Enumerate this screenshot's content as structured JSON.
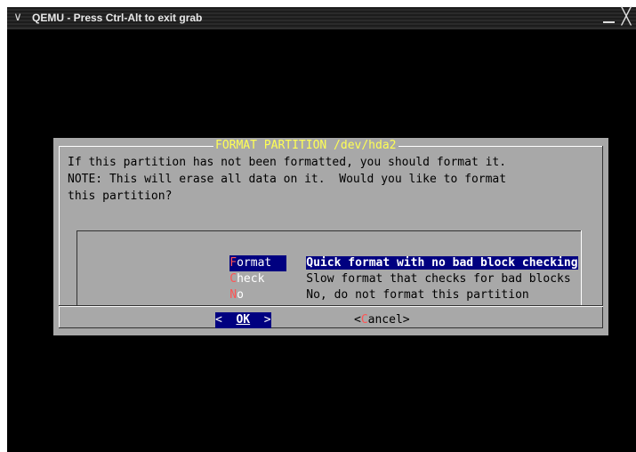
{
  "window": {
    "title": "QEMU - Press Ctrl-Alt to exit grab",
    "menu_glyph": "∨",
    "close_glyph": "╳"
  },
  "dialog": {
    "title": "FORMAT PARTITION /dev/hda2",
    "message_lines": [
      "If this partition has not been formatted, you should format it.",
      "NOTE: This will erase all data on it.  Would you like to format",
      "this partition?"
    ],
    "options": [
      {
        "hotkey": "F",
        "tag_rest": "ormat",
        "description": "Quick format with no bad block checking",
        "selected": true
      },
      {
        "hotkey": "C",
        "tag_rest": "heck",
        "description": "Slow format that checks for bad blocks",
        "selected": false
      },
      {
        "hotkey": "N",
        "tag_rest": "o",
        "description": "No, do not format this partition",
        "selected": false
      }
    ],
    "ok_button": {
      "left": "<  ",
      "hot": "OK",
      "right": "  >"
    },
    "cancel_button": {
      "left": "<",
      "hot": "C",
      "right": "ancel>"
    }
  },
  "colors": {
    "dialog_bg": "#a8a8a8",
    "title_text": "#ffff54",
    "hotkey": "#ff5454",
    "selection_bg": "#000080"
  }
}
